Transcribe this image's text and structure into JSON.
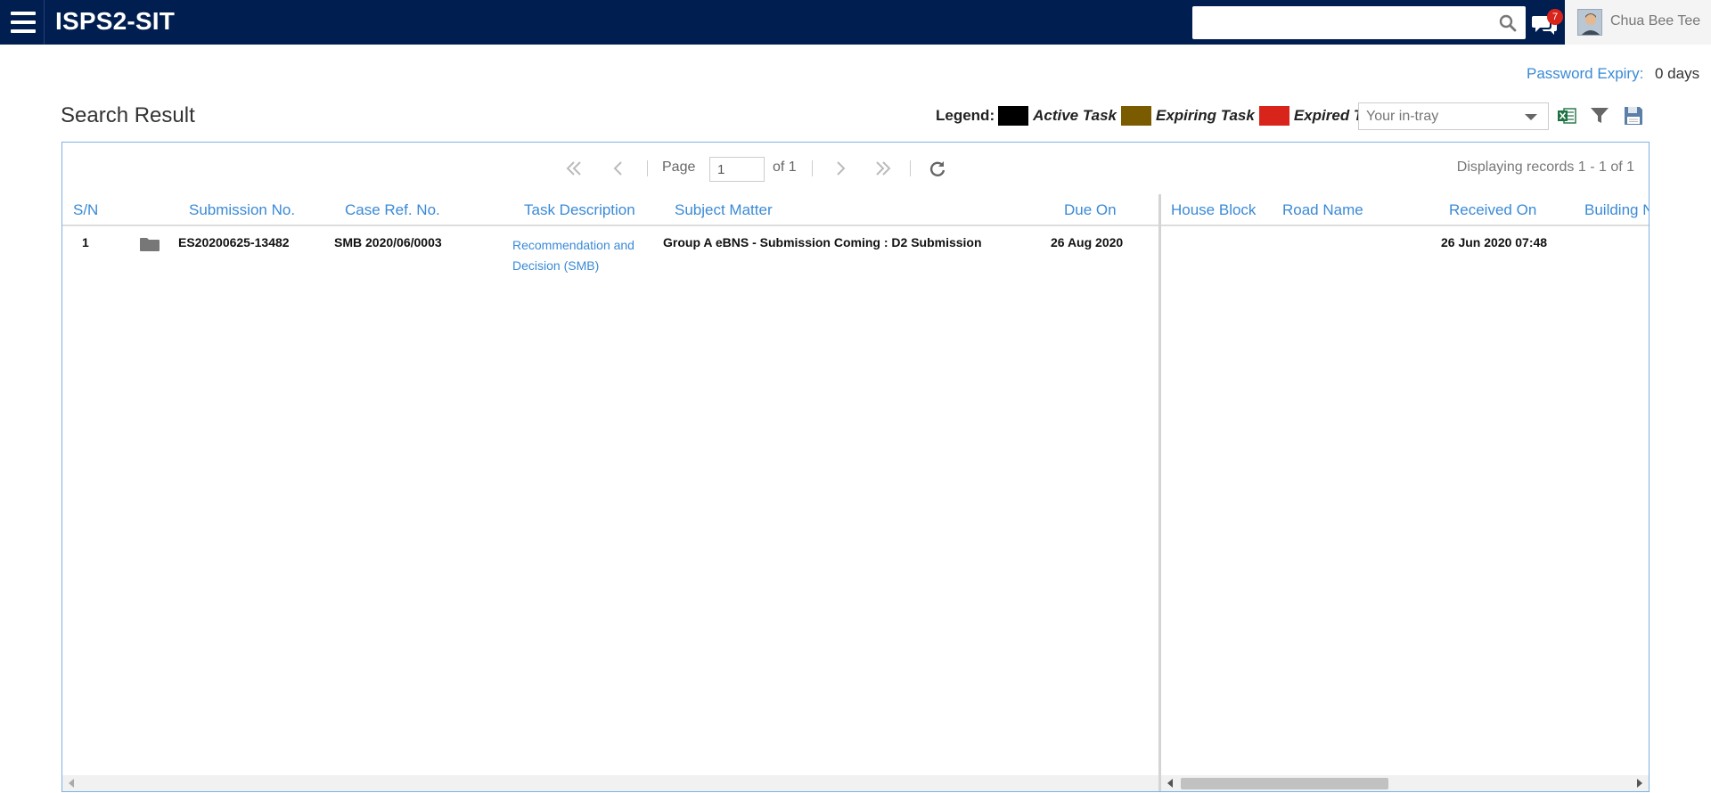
{
  "header": {
    "app_title": "ISPS2-SIT",
    "search_placeholder": "",
    "notification_count": "7",
    "user_name": "Chua Bee Tee"
  },
  "password_expiry": {
    "label": "Password Expiry:",
    "value": "0 days"
  },
  "page_title": "Search Result",
  "legend": {
    "title": "Legend:",
    "items": [
      {
        "label": "Active Task",
        "color": "#000000"
      },
      {
        "label": "Expiring Task",
        "color": "#7a5b00"
      },
      {
        "label": "Expired Task",
        "color": "#d9241b"
      }
    ]
  },
  "tray_select": {
    "selected": "Your in-tray"
  },
  "toolbar_icons": [
    "excel-export-icon",
    "filter-icon",
    "save-icon"
  ],
  "pager": {
    "page_label": "Page",
    "page_value": "1",
    "of_label": "of 1",
    "display_text": "Displaying records 1 - 1 of 1"
  },
  "columns_left": [
    "S/N",
    "Submission No.",
    "Case Ref. No.",
    "Task Description",
    "Subject Matter",
    "Due On"
  ],
  "columns_right": [
    "House Block",
    "Road Name",
    "Received On",
    "Building N"
  ],
  "rows": [
    {
      "sn": "1",
      "submission_no": "ES20200625-13482",
      "case_ref": "SMB 2020/06/0003",
      "task_description": "Recommendation and Decision (SMB)",
      "subject_matter": "Group A eBNS - Submission Coming : D2 Submission",
      "due_on": "26 Aug 2020",
      "house_block": "",
      "road_name": "",
      "received_on": "26 Jun 2020 07:48"
    }
  ]
}
